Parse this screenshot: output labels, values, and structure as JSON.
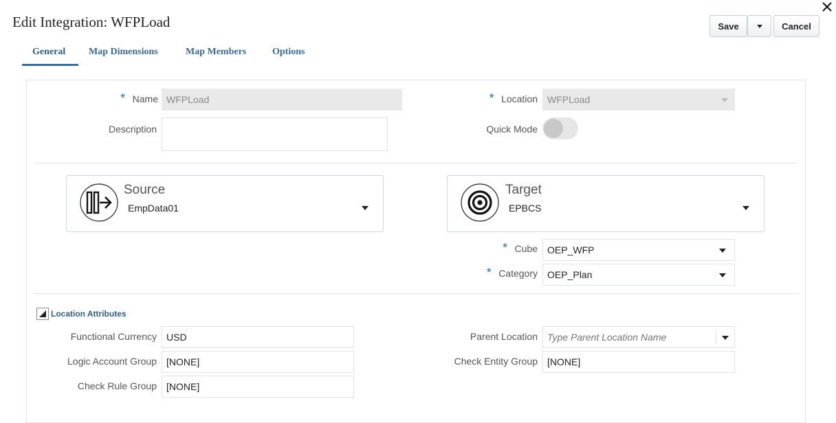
{
  "header": {
    "title": "Edit Integration: WFPLoad",
    "save_label": "Save",
    "cancel_label": "Cancel"
  },
  "tabs": [
    {
      "label": "General",
      "active": true
    },
    {
      "label": "Map Dimensions",
      "active": false
    },
    {
      "label": "Map Members",
      "active": false
    },
    {
      "label": "Options",
      "active": false
    }
  ],
  "general": {
    "name_label": "Name",
    "name_value": "WFPLoad",
    "description_label": "Description",
    "description_value": "",
    "location_label": "Location",
    "location_value": "WFPLoad",
    "quick_mode_label": "Quick Mode",
    "quick_mode_on": false
  },
  "source": {
    "heading": "Source",
    "value": "EmpData01"
  },
  "target": {
    "heading": "Target",
    "value": "EPBCS",
    "cube_label": "Cube",
    "cube_value": "OEP_WFP",
    "category_label": "Category",
    "category_value": "OEP_Plan"
  },
  "location_attributes": {
    "heading": "Location Attributes",
    "functional_currency_label": "Functional Currency",
    "functional_currency_value": "USD",
    "logic_account_group_label": "Logic Account Group",
    "logic_account_group_value": "[NONE]",
    "check_rule_group_label": "Check Rule Group",
    "check_rule_group_value": "[NONE]",
    "parent_location_label": "Parent Location",
    "parent_location_placeholder": "Type Parent Location Name",
    "check_entity_group_label": "Check Entity Group",
    "check_entity_group_value": "[NONE]"
  },
  "colors": {
    "accent": "#2f6fa5",
    "tab_text": "#3a6a94",
    "border": "#dfe3e6"
  }
}
